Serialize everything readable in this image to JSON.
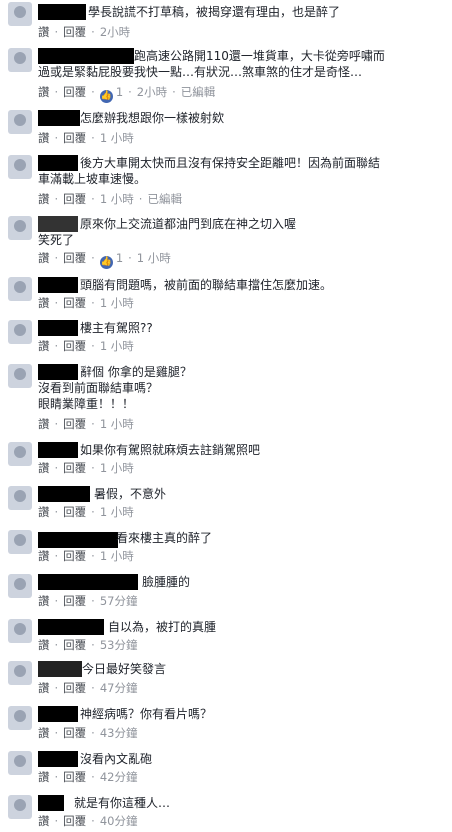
{
  "actions": {
    "like": "讚",
    "reply": "回覆",
    "dot": "·",
    "edited": "已編輯"
  },
  "comments": [
    {
      "text": "學長說謊不打草稿，被揭穿還有理由，也是醉了",
      "likes": "",
      "time": "2小時",
      "edited": false
    },
    {
      "text": "跑高速公路開110還一堆貨車，大卡從旁呼嘯而\n過或是緊黏屁股要我快一點…有狀況…煞車煞的住才是奇怪…",
      "likes": "1",
      "time": "2小時",
      "edited": true
    },
    {
      "text": "怎麼辦我想跟你一樣被射欸",
      "likes": "",
      "time": "1 小時",
      "edited": false
    },
    {
      "text": "後方大車開太快而且沒有保持安全距離吧！因為前面聯結\n車滿載上坡車速慢。",
      "likes": "",
      "time": "1 小時",
      "edited": true
    },
    {
      "text": "原來你上交流道都油門到底在神之切入喔\n笑死了",
      "likes": "1",
      "time": "1 小時",
      "edited": false
    },
    {
      "text": "頭腦有問題嗎，被前面的聯結車擋住怎麼加速。",
      "likes": "",
      "time": "1 小時",
      "edited": false
    },
    {
      "text": "樓主有駕照??",
      "likes": "",
      "time": "1 小時",
      "edited": false
    },
    {
      "text": "辭個 你拿的是雞腿？\n沒看到前面聯結車嗎？\n眼睛業障重！！！",
      "likes": "",
      "time": "1 小時",
      "edited": false
    },
    {
      "text": "如果你有駕照就麻煩去註銷駕照吧",
      "likes": "",
      "time": "1 小時",
      "edited": false
    },
    {
      "text": "暑假，不意外",
      "likes": "",
      "time": "1 小時",
      "edited": false
    },
    {
      "text": "看來樓主真的醉了",
      "likes": "",
      "time": "1 小時",
      "edited": false
    },
    {
      "text": "臉腫腫的",
      "likes": "",
      "time": "57分鐘",
      "edited": false
    },
    {
      "text": "自以為，被打的真腫",
      "likes": "",
      "time": "53分鐘",
      "edited": false
    },
    {
      "text": "今日最好笑發言",
      "likes": "",
      "time": "47分鐘",
      "edited": false
    },
    {
      "text": "神經病嗎？你有看片嗎？",
      "likes": "",
      "time": "43分鐘",
      "edited": false
    },
    {
      "text": "沒看內文亂砲",
      "likes": "",
      "time": "42分鐘",
      "edited": false
    },
    {
      "text": "就是有你這種人…",
      "likes": "",
      "time": "40分鐘",
      "edited": false
    }
  ]
}
